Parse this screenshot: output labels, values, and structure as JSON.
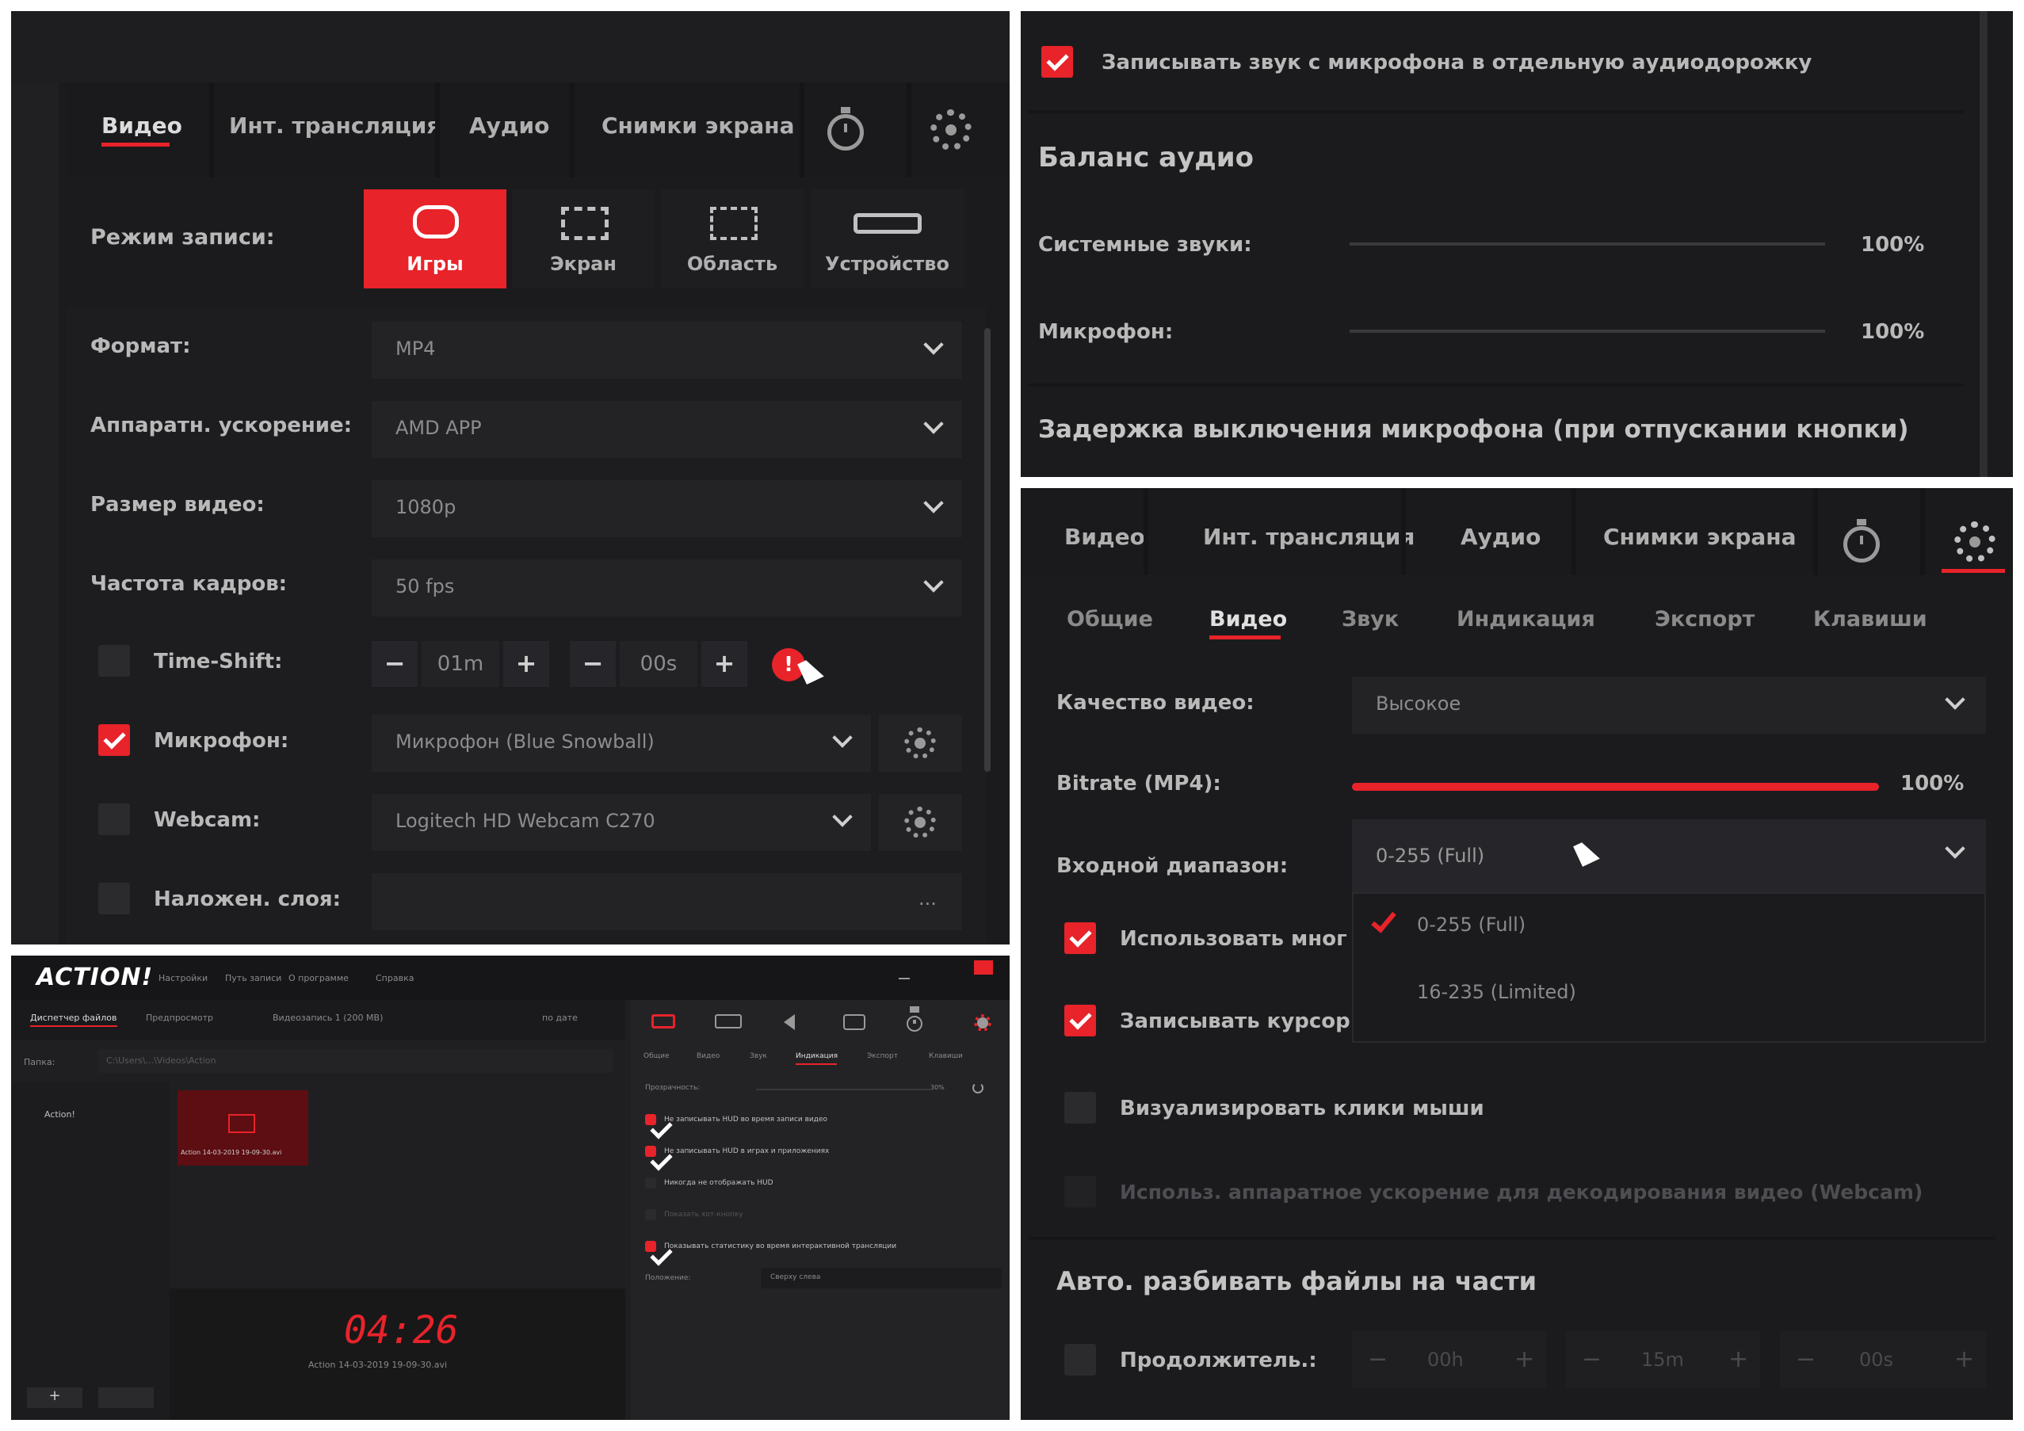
{
  "p1": {
    "tabs": [
      "Видео",
      "Инт. трансляция",
      "Аудио",
      "Снимки экрана"
    ],
    "mode_label": "Режим записи:",
    "modes": [
      "Игры",
      "Экран",
      "Область",
      "Устройство"
    ],
    "rows": [
      {
        "label": "Формат:",
        "value": "MP4"
      },
      {
        "label": "Аппаратн. ускорение:",
        "value": "AMD APP"
      },
      {
        "label": "Размер видео:",
        "value": "1080p"
      },
      {
        "label": "Частота кадров:",
        "value": "50 fps"
      }
    ],
    "timeshift": {
      "label": "Time-Shift:",
      "minutes": "01m",
      "seconds": "00s",
      "minus": "−",
      "plus": "+",
      "info": "!"
    },
    "mic": {
      "label": "Микрофон:",
      "value": "Микрофон (Blue Snowball)"
    },
    "webcam": {
      "label": "Webcam:",
      "value": "Logitech HD Webcam C270"
    },
    "overlay": {
      "label": "Наложен. слоя:",
      "dots": "..."
    }
  },
  "p2": {
    "mic_track": "Записывать звук с микрофона в отдельную аудиодорожку",
    "balance_title": "Баланс аудио",
    "system_label": "Системные звуки:",
    "system_value": "100%",
    "mic_label": "Микрофон:",
    "mic_value": "100%",
    "delay_title": "Задержка выключения микрофона (при отпускании кнопки)"
  },
  "p3": {
    "app_logo": "ACTION!",
    "menu": [
      "Настройки",
      "Путь записи",
      "О программе",
      "Справка"
    ],
    "left_tabs": [
      "Диспетчер файлов",
      "Предпросмотр",
      "Видеозапись 1 (200 MB)"
    ],
    "sort": "по дате",
    "folder_label": "Папка:",
    "folder_value": "C:\\Users\\...\\Videos\\Action",
    "tree_item": "Action!",
    "thumb_caption": "Action 14-03-2019 19-09-30.avi",
    "timer": "04:26",
    "file_name": "Action 14-03-2019 19-09-30.avi",
    "add": "+",
    "sub_tabs": [
      "Общие",
      "Видео",
      "Звук",
      "Индикация",
      "Экспорт",
      "Клавиши"
    ],
    "transparency_label": "Прозрачность:",
    "transparency_value": "30%",
    "options": [
      {
        "text": "Не записывать HUD во время записи видео",
        "on": true
      },
      {
        "text": "Не записывать HUD в играх и приложениях",
        "on": true
      },
      {
        "text": "Никогда не отображать HUD",
        "on": false
      },
      {
        "text": "Показать хот-кнопку",
        "on": false
      },
      {
        "text": "Показывать статистику во время интерактивной трансляции",
        "on": true
      }
    ],
    "position_label": "Положение:",
    "position_value": "Сверху слева"
  },
  "p4": {
    "tabs": [
      "Видео",
      "Инт. трансляция",
      "Аудио",
      "Снимки экрана"
    ],
    "sub_tabs": [
      "Общие",
      "Видео",
      "Звук",
      "Индикация",
      "Экспорт",
      "Клавиши"
    ],
    "quality_label": "Качество видео:",
    "quality_value": "Высокое",
    "bitrate_label": "Bitrate (MP4):",
    "bitrate_value": "100%",
    "bitrate_level": 1.0,
    "range_label": "Входной диапазон:",
    "range_value": "0-255 (Full)",
    "range_options": [
      "0-255 (Full)",
      "16-235 (Limited)"
    ],
    "use_multi": "Использовать мног",
    "record_cursor": "Записывать курсор",
    "visualize_clicks": "Визуализировать клики мыши",
    "hw_decode": "Использ. аппаратное ускорение для декодирования видео (Webcam)",
    "split_title": "Авто. разбивать файлы на части",
    "duration_label": "Продолжитель.:",
    "dur_h": "00h",
    "dur_m": "15m",
    "dur_s": "00s"
  }
}
